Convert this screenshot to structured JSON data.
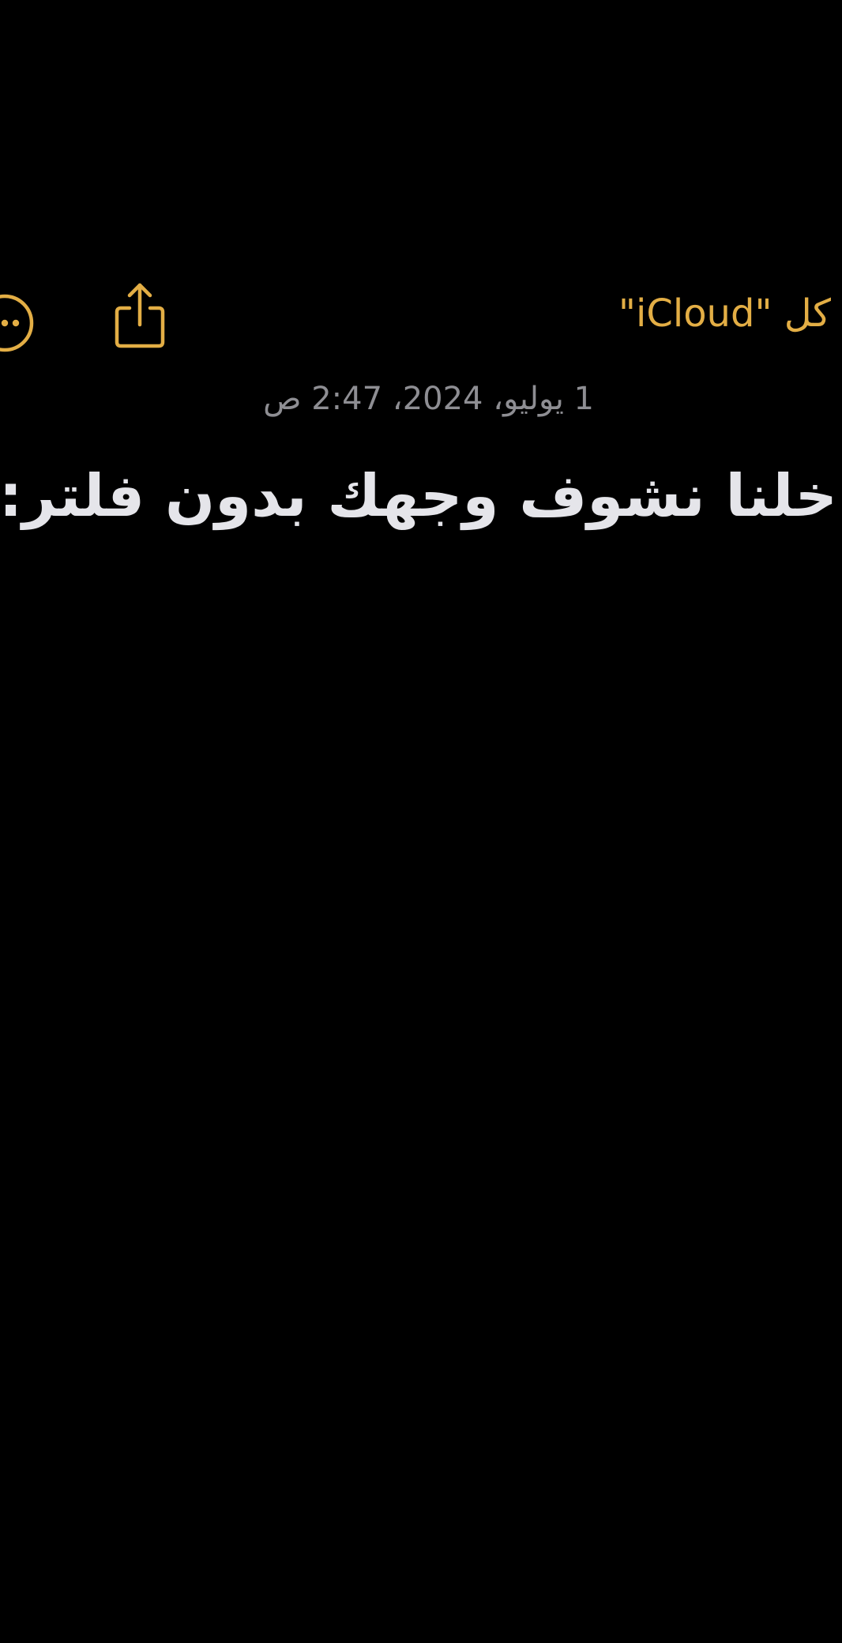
{
  "nav": {
    "back_label": "كل \"iCloud\"",
    "share_icon": "share-icon",
    "more_icon": "ellipsis-circle-icon"
  },
  "note": {
    "date": "1 يوليو، 2024، 2:47 ص",
    "body": "خلنا نشوف وجهك بدون فلتر:"
  },
  "colors": {
    "accent": "#E3AE45",
    "background": "#000000",
    "date_text": "#8E8E93",
    "body_text": "#E5E5EA"
  }
}
